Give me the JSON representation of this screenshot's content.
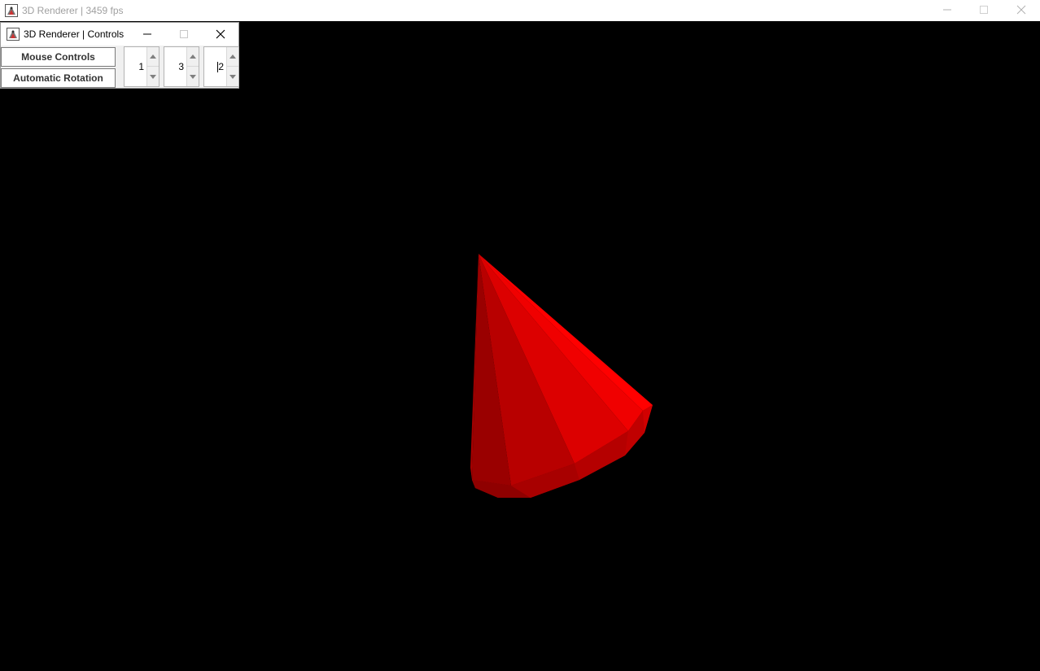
{
  "main_window": {
    "title": "3D Renderer | 3459 fps",
    "icon": "java-app-icon",
    "buttons": {
      "minimize": "minimize-icon",
      "maximize": "maximize-icon",
      "close": "close-icon"
    }
  },
  "controls_window": {
    "title": "3D Renderer | Controls",
    "icon": "java-app-icon",
    "mouse_controls_label": "Mouse Controls",
    "automatic_rotation_label": "Automatic Rotation",
    "spinners": [
      {
        "value": "1"
      },
      {
        "value": "3"
      },
      {
        "value": "2"
      }
    ]
  },
  "scene": {
    "object": "cone",
    "color": "#ff0000",
    "background": "#000000"
  }
}
